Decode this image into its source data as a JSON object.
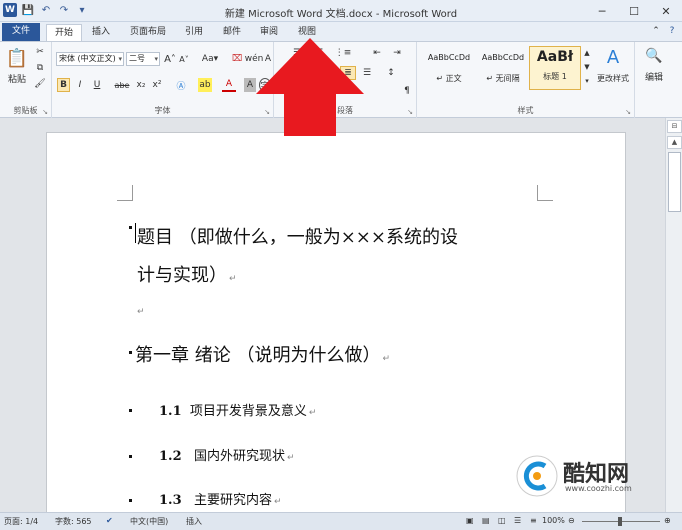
{
  "window": {
    "title": "新建 Microsoft Word 文档.docx - Microsoft Word",
    "app_logo": "W"
  },
  "qat": {
    "icons": [
      "word-logo",
      "save-icon",
      "undo-icon",
      "redo-icon",
      "customize-icon"
    ]
  },
  "tabs": [
    "文件",
    "开始",
    "插入",
    "页面布局",
    "引用",
    "邮件",
    "审阅",
    "视图"
  ],
  "active_tab": "开始",
  "ribbon": {
    "clipboard": {
      "paste_label": "粘贴",
      "group_label": "剪贴板"
    },
    "font": {
      "font_name": "宋体 (中文正文)",
      "font_size": "二号",
      "group_label": "字体",
      "format_buttons": [
        "B",
        "I",
        "U",
        "abe",
        "x₂",
        "x²",
        "A",
        "A"
      ]
    },
    "paragraph": {
      "group_label": "段落"
    },
    "styles": {
      "group_label": "样式",
      "items": [
        {
          "sample": "AaBbCcDd",
          "name": "↵ 正文"
        },
        {
          "sample": "AaBbCcDd",
          "name": "↵ 无间隔"
        },
        {
          "sample": "AaBł",
          "name": "标题 1"
        }
      ],
      "change_styles_label": "更改样式"
    },
    "editing": {
      "label": "编辑"
    }
  },
  "document": {
    "heading_line1": "题目  （即做什么，一般为×××系统的设",
    "heading_line2": "计与实现）",
    "chapter": "第一章  绪论  （说明为什么做）",
    "items": [
      {
        "num": "1.1",
        "text": "项目开发背景及意义"
      },
      {
        "num": "1.2",
        "text": "国内外研究现状"
      },
      {
        "num": "1.3",
        "text": "主要研究内容"
      }
    ],
    "para_mark": "↵"
  },
  "status": {
    "page": "页面: 1/4",
    "words": "字数: 565",
    "language": "中文(中国)",
    "mode": "插入",
    "zoom": "100%"
  },
  "watermark": {
    "brand": "酷知网",
    "url": "www.coozhi.com"
  },
  "colors": {
    "accent": "#2b579a",
    "arrow": "#e8191f"
  }
}
